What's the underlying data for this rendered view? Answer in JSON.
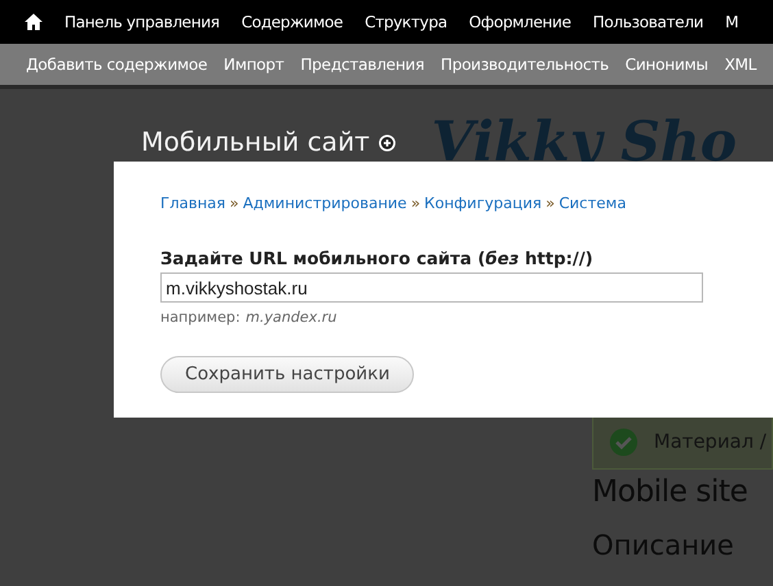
{
  "top_menu": [
    {
      "label": "Панель управления"
    },
    {
      "label": "Содержимое"
    },
    {
      "label": "Структура"
    },
    {
      "label": "Оформление"
    },
    {
      "label": "Пользователи"
    },
    {
      "label": "М"
    }
  ],
  "shortcuts": [
    {
      "label": "Добавить содержимое"
    },
    {
      "label": "Импорт"
    },
    {
      "label": "Представления"
    },
    {
      "label": "Производительность"
    },
    {
      "label": "Синонимы"
    },
    {
      "label": "XML"
    }
  ],
  "page_title": "Мобильный сайт",
  "logo_text": "Vikky Sho",
  "background": {
    "message": "Материал /",
    "heading": "Mobile site",
    "subheading": "Описание"
  },
  "dialog": {
    "breadcrumb_separator": "»",
    "breadcrumb": [
      {
        "label": "Главная"
      },
      {
        "label": "Администрирование"
      },
      {
        "label": "Конфигурация"
      },
      {
        "label": "Система"
      }
    ],
    "field_label": "Задайте URL мобильного сайта (*без* http://)",
    "value": "m.vikkyshostak.ru",
    "hint_prefix": "например:",
    "hint_example": "m.yandex.ru",
    "button": "Сохранить настройки"
  }
}
